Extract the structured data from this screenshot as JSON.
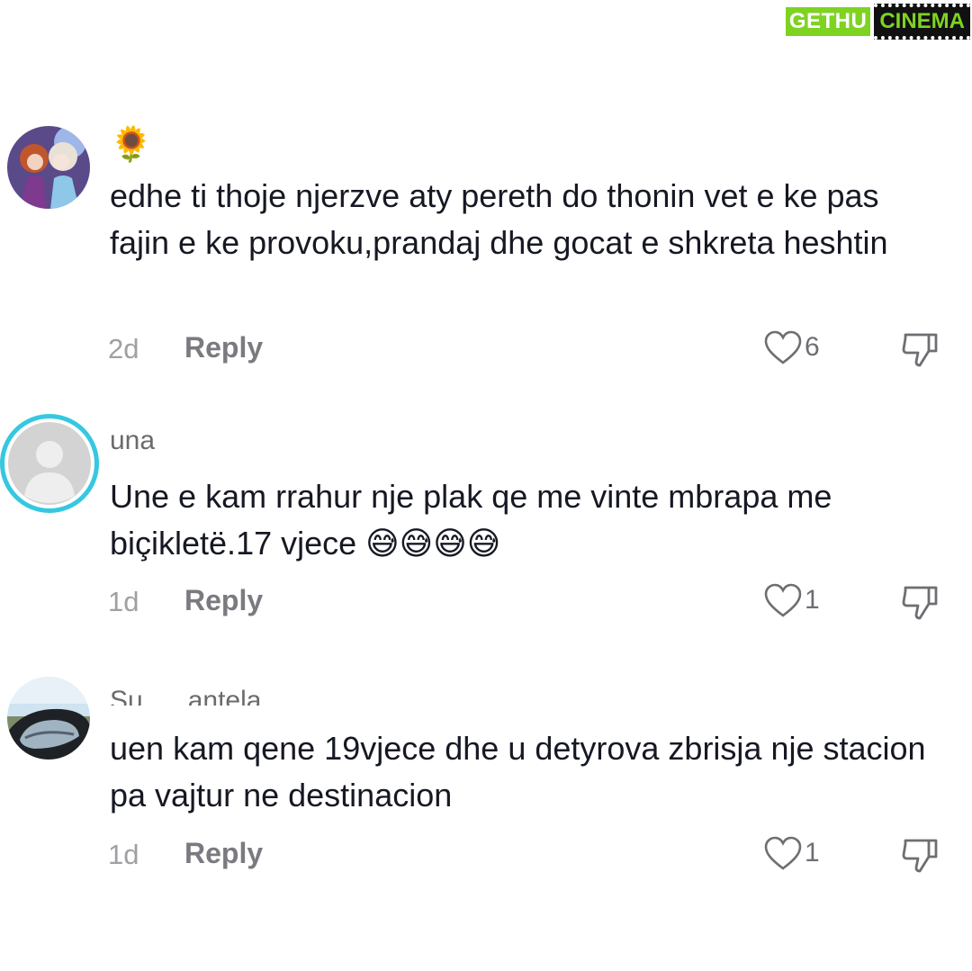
{
  "watermark": {
    "left": "GETHU",
    "right": "CINEMA"
  },
  "comments": [
    {
      "username": "🌻",
      "text": "edhe ti thoje njerzve aty pereth do thonin vet e ke pas fajin e ke provoku,prandaj dhe gocat e shkreta heshtin",
      "time": "2d",
      "reply_label": "Reply",
      "likes": "6",
      "avatar_icon": "anime-girls-avatar"
    },
    {
      "username": "una",
      "text": "Une e kam rrahur nje plak qe me vinte mbrapa me biçikletë.17 vjece 😅😅😅😅",
      "time": "1d",
      "reply_label": "Reply",
      "likes": "1",
      "avatar_icon": "default-user-avatar"
    },
    {
      "username": "Su      antela",
      "text": "uen kam qene 19vjece dhe u detyrova zbrisja nje stacion pa vajtur ne destinacion",
      "time": "1d",
      "reply_label": "Reply",
      "likes": "1",
      "avatar_icon": "car-mirror-avatar"
    }
  ],
  "colors": {
    "text": "#161823",
    "muted": "#a0a0a4",
    "ring": "#35c8e0",
    "watermark_green": "#7ed321"
  }
}
